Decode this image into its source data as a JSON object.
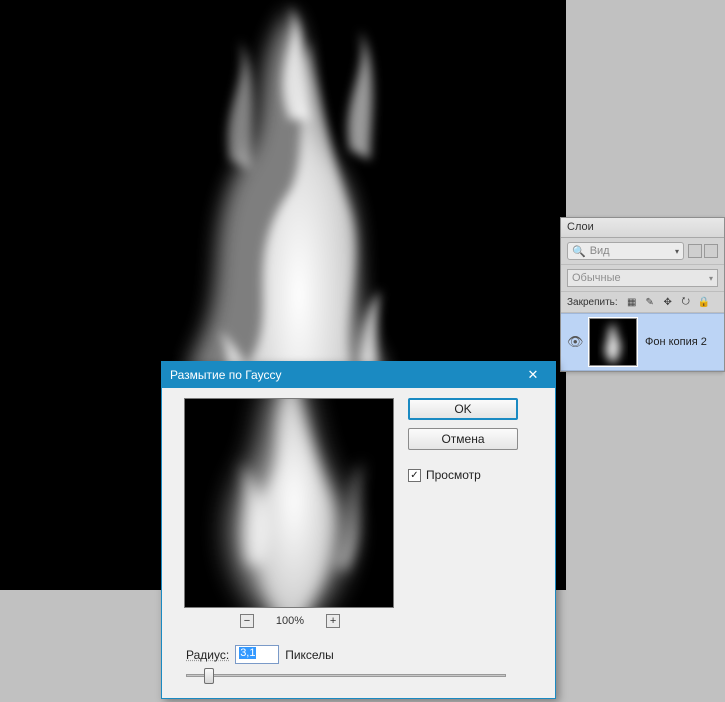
{
  "canvas": {
    "bg": "#000000"
  },
  "layers_panel": {
    "tab_label": "Слои",
    "search_placeholder": "Вид",
    "blend_mode": "Обычные",
    "lock_label": "Закрепить:",
    "layer": {
      "name": "Фон копия 2",
      "visible": true
    }
  },
  "dialog": {
    "title": "Размытие по Гауссу",
    "ok_label": "OK",
    "cancel_label": "Отмена",
    "preview_label": "Просмотр",
    "preview_checked": true,
    "zoom_level": "100%",
    "radius_label": "Радиус:",
    "radius_value": "3,1",
    "radius_units": "Пикселы"
  }
}
